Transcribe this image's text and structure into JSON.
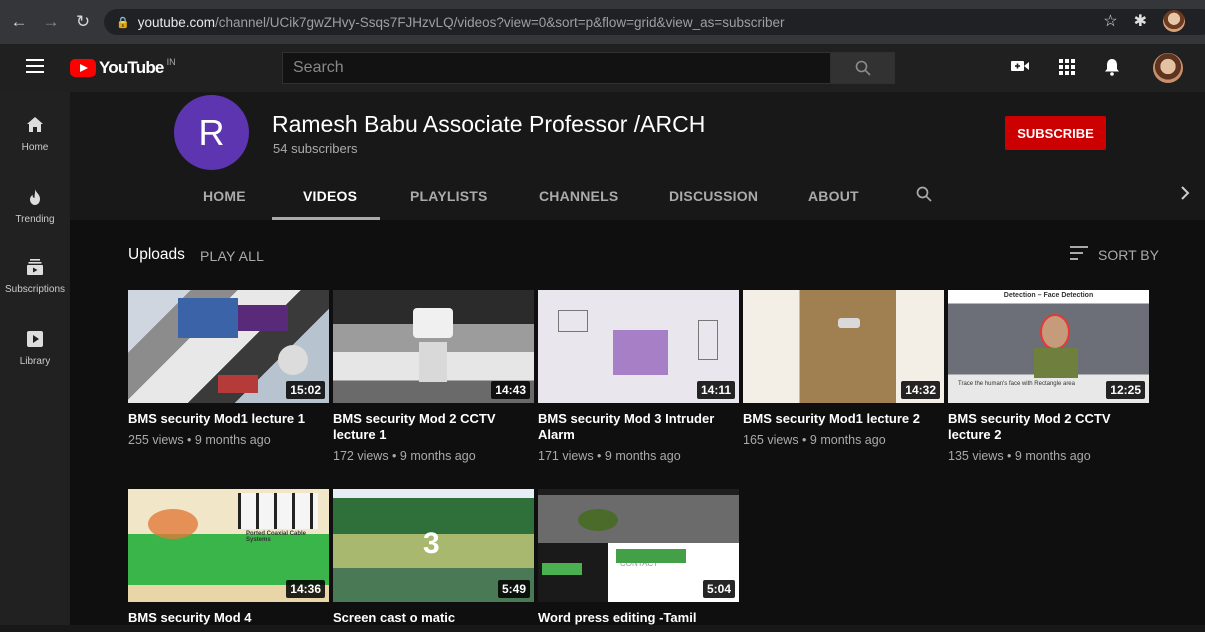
{
  "browser": {
    "url_host": "youtube.com",
    "url_path": "/channel/UCik7gwZHvy-Ssqs7FJHzvLQ/videos?view=0&sort=p&flow=grid&view_as=subscriber"
  },
  "header": {
    "logo_text": "YouTube",
    "logo_region": "IN",
    "search_placeholder": "Search"
  },
  "sidebar": {
    "items": [
      {
        "label": "Home"
      },
      {
        "label": "Trending"
      },
      {
        "label": "Subscriptions"
      },
      {
        "label": "Library"
      }
    ]
  },
  "channel": {
    "avatar_letter": "R",
    "avatar_color": "#5e35b1",
    "title": "Ramesh Babu Associate Professor /ARCH",
    "subscribers": "54 subscribers",
    "subscribe_label": "SUBSCRIBE",
    "tabs": [
      "HOME",
      "VIDEOS",
      "PLAYLISTS",
      "CHANNELS",
      "DISCUSSION",
      "ABOUT"
    ],
    "active_tab": "VIDEOS"
  },
  "content": {
    "section_title": "Uploads",
    "play_all": "PLAY ALL",
    "sort_by": "SORT BY",
    "videos": [
      {
        "title": "BMS security Mod1 lecture 1",
        "meta": "255 views • 9 months ago",
        "duration": "15:02"
      },
      {
        "title": "BMS security Mod 2 CCTV lecture 1",
        "meta": "172 views • 9 months ago",
        "duration": "14:43"
      },
      {
        "title": "BMS security Mod 3 Intruder Alarm",
        "meta": "171 views • 9 months ago",
        "duration": "14:11"
      },
      {
        "title": "BMS security Mod1 lecture 2",
        "meta": "165 views • 9 months ago",
        "duration": "14:32"
      },
      {
        "title": "BMS security Mod 2 CCTV lecture 2",
        "meta": "135 views • 9 months ago",
        "duration": "12:25"
      },
      {
        "title": "BMS security Mod 4",
        "meta": "",
        "duration": "14:36"
      },
      {
        "title": "Screen cast o matic",
        "meta": "",
        "duration": "5:49"
      },
      {
        "title": "Word press editing -Tamil",
        "meta": "",
        "duration": "5:04"
      }
    ],
    "thumb_text": {
      "t5_top": "Detection – Face Detection",
      "t5_caption": "Trace the human's face with Rectangle area",
      "t6_caption": "Ported Coaxial Cable Systems",
      "t7_number": "3",
      "t8_contact": "CONTACT"
    }
  },
  "colors": {
    "subscribe_red": "#cc0000",
    "youtube_red": "#ff0000"
  }
}
